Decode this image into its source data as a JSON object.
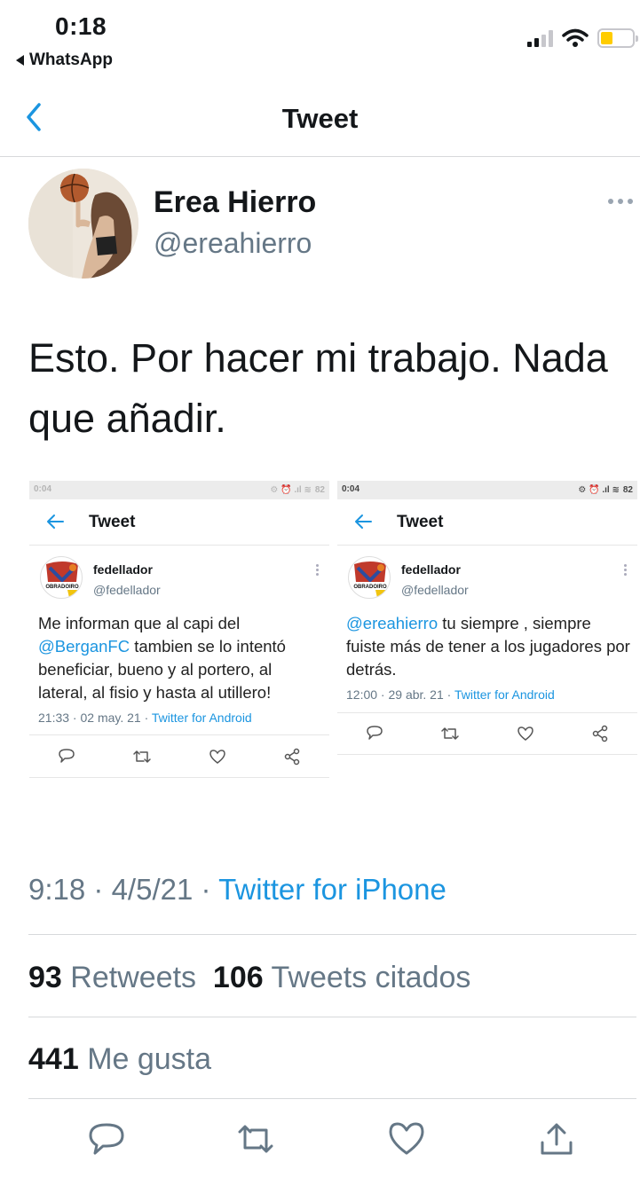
{
  "status_bar": {
    "time": "0:18",
    "back_app": "WhatsApp",
    "battery_color": "#ffcc00"
  },
  "nav": {
    "title": "Tweet",
    "back_icon": "chevron-left-icon"
  },
  "tweet": {
    "author_name": "Erea Hierro",
    "author_handle": "@ereahierro",
    "text": "Esto. Por hacer mi trabajo. Nada que añadir.",
    "time": "9:18",
    "date": "4/5/21",
    "source": "Twitter for iPhone",
    "separator": "·",
    "retweets_count": "93",
    "retweets_label": "Retweets",
    "quotes_count": "106",
    "quotes_label": "Tweets citados",
    "likes_count": "441",
    "likes_label": "Me gusta"
  },
  "embedded_screenshots": [
    {
      "status_time": "0:04",
      "battery": "82",
      "title": "Tweet",
      "name": "fedellador",
      "handle": "@fedellador",
      "logo_text": "OBRADOIRO",
      "text_before": "Me informan que al capi del ",
      "mention": "@BerganFC",
      "text_after": " tambien se lo intentó beneficiar, bueno y al portero, al lateral, al fisio y hasta al utillero!",
      "meta_time": "21:33 · 02 may. 21 · ",
      "meta_source": "Twitter for Android"
    },
    {
      "status_time": "0:04",
      "battery": "82",
      "title": "Tweet",
      "name": "fedellador",
      "handle": "@fedellador",
      "logo_text": "OBRADOIRO",
      "text_before": "",
      "mention": "@ereahierro",
      "text_after": " tu siempre , siempre fuiste más de tener a los jugadores por detrás.",
      "meta_time": "12:00 · 29 abr. 21 · ",
      "meta_source": "Twitter for Android"
    }
  ],
  "actions": [
    "reply-icon",
    "retweet-icon",
    "like-icon",
    "share-icon"
  ],
  "colors": {
    "accent": "#1b95e0",
    "text": "#14171a",
    "secondary": "#657786",
    "divider": "#d7d9db"
  }
}
